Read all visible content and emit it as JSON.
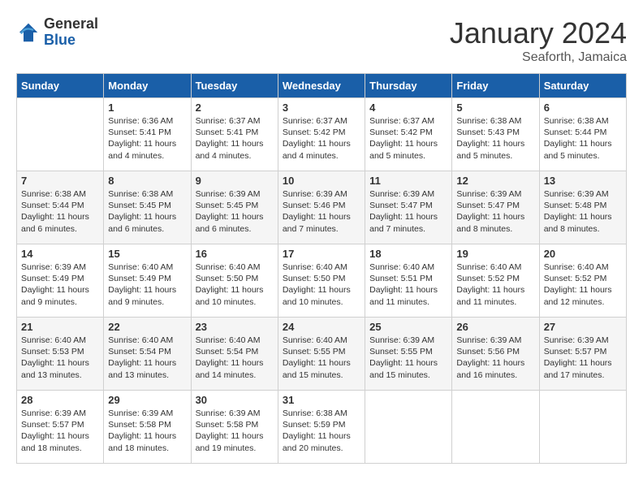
{
  "header": {
    "logo_general": "General",
    "logo_blue": "Blue",
    "month": "January 2024",
    "location": "Seaforth, Jamaica"
  },
  "weekdays": [
    "Sunday",
    "Monday",
    "Tuesday",
    "Wednesday",
    "Thursday",
    "Friday",
    "Saturday"
  ],
  "weeks": [
    [
      {
        "day": "",
        "info": ""
      },
      {
        "day": "1",
        "info": "Sunrise: 6:36 AM\nSunset: 5:41 PM\nDaylight: 11 hours\nand 4 minutes."
      },
      {
        "day": "2",
        "info": "Sunrise: 6:37 AM\nSunset: 5:41 PM\nDaylight: 11 hours\nand 4 minutes."
      },
      {
        "day": "3",
        "info": "Sunrise: 6:37 AM\nSunset: 5:42 PM\nDaylight: 11 hours\nand 4 minutes."
      },
      {
        "day": "4",
        "info": "Sunrise: 6:37 AM\nSunset: 5:42 PM\nDaylight: 11 hours\nand 5 minutes."
      },
      {
        "day": "5",
        "info": "Sunrise: 6:38 AM\nSunset: 5:43 PM\nDaylight: 11 hours\nand 5 minutes."
      },
      {
        "day": "6",
        "info": "Sunrise: 6:38 AM\nSunset: 5:44 PM\nDaylight: 11 hours\nand 5 minutes."
      }
    ],
    [
      {
        "day": "7",
        "info": "Sunrise: 6:38 AM\nSunset: 5:44 PM\nDaylight: 11 hours\nand 6 minutes."
      },
      {
        "day": "8",
        "info": "Sunrise: 6:38 AM\nSunset: 5:45 PM\nDaylight: 11 hours\nand 6 minutes."
      },
      {
        "day": "9",
        "info": "Sunrise: 6:39 AM\nSunset: 5:45 PM\nDaylight: 11 hours\nand 6 minutes."
      },
      {
        "day": "10",
        "info": "Sunrise: 6:39 AM\nSunset: 5:46 PM\nDaylight: 11 hours\nand 7 minutes."
      },
      {
        "day": "11",
        "info": "Sunrise: 6:39 AM\nSunset: 5:47 PM\nDaylight: 11 hours\nand 7 minutes."
      },
      {
        "day": "12",
        "info": "Sunrise: 6:39 AM\nSunset: 5:47 PM\nDaylight: 11 hours\nand 8 minutes."
      },
      {
        "day": "13",
        "info": "Sunrise: 6:39 AM\nSunset: 5:48 PM\nDaylight: 11 hours\nand 8 minutes."
      }
    ],
    [
      {
        "day": "14",
        "info": "Sunrise: 6:39 AM\nSunset: 5:49 PM\nDaylight: 11 hours\nand 9 minutes."
      },
      {
        "day": "15",
        "info": "Sunrise: 6:40 AM\nSunset: 5:49 PM\nDaylight: 11 hours\nand 9 minutes."
      },
      {
        "day": "16",
        "info": "Sunrise: 6:40 AM\nSunset: 5:50 PM\nDaylight: 11 hours\nand 10 minutes."
      },
      {
        "day": "17",
        "info": "Sunrise: 6:40 AM\nSunset: 5:50 PM\nDaylight: 11 hours\nand 10 minutes."
      },
      {
        "day": "18",
        "info": "Sunrise: 6:40 AM\nSunset: 5:51 PM\nDaylight: 11 hours\nand 11 minutes."
      },
      {
        "day": "19",
        "info": "Sunrise: 6:40 AM\nSunset: 5:52 PM\nDaylight: 11 hours\nand 11 minutes."
      },
      {
        "day": "20",
        "info": "Sunrise: 6:40 AM\nSunset: 5:52 PM\nDaylight: 11 hours\nand 12 minutes."
      }
    ],
    [
      {
        "day": "21",
        "info": "Sunrise: 6:40 AM\nSunset: 5:53 PM\nDaylight: 11 hours\nand 13 minutes."
      },
      {
        "day": "22",
        "info": "Sunrise: 6:40 AM\nSunset: 5:54 PM\nDaylight: 11 hours\nand 13 minutes."
      },
      {
        "day": "23",
        "info": "Sunrise: 6:40 AM\nSunset: 5:54 PM\nDaylight: 11 hours\nand 14 minutes."
      },
      {
        "day": "24",
        "info": "Sunrise: 6:40 AM\nSunset: 5:55 PM\nDaylight: 11 hours\nand 15 minutes."
      },
      {
        "day": "25",
        "info": "Sunrise: 6:39 AM\nSunset: 5:55 PM\nDaylight: 11 hours\nand 15 minutes."
      },
      {
        "day": "26",
        "info": "Sunrise: 6:39 AM\nSunset: 5:56 PM\nDaylight: 11 hours\nand 16 minutes."
      },
      {
        "day": "27",
        "info": "Sunrise: 6:39 AM\nSunset: 5:57 PM\nDaylight: 11 hours\nand 17 minutes."
      }
    ],
    [
      {
        "day": "28",
        "info": "Sunrise: 6:39 AM\nSunset: 5:57 PM\nDaylight: 11 hours\nand 18 minutes."
      },
      {
        "day": "29",
        "info": "Sunrise: 6:39 AM\nSunset: 5:58 PM\nDaylight: 11 hours\nand 18 minutes."
      },
      {
        "day": "30",
        "info": "Sunrise: 6:39 AM\nSunset: 5:58 PM\nDaylight: 11 hours\nand 19 minutes."
      },
      {
        "day": "31",
        "info": "Sunrise: 6:38 AM\nSunset: 5:59 PM\nDaylight: 11 hours\nand 20 minutes."
      },
      {
        "day": "",
        "info": ""
      },
      {
        "day": "",
        "info": ""
      },
      {
        "day": "",
        "info": ""
      }
    ]
  ]
}
